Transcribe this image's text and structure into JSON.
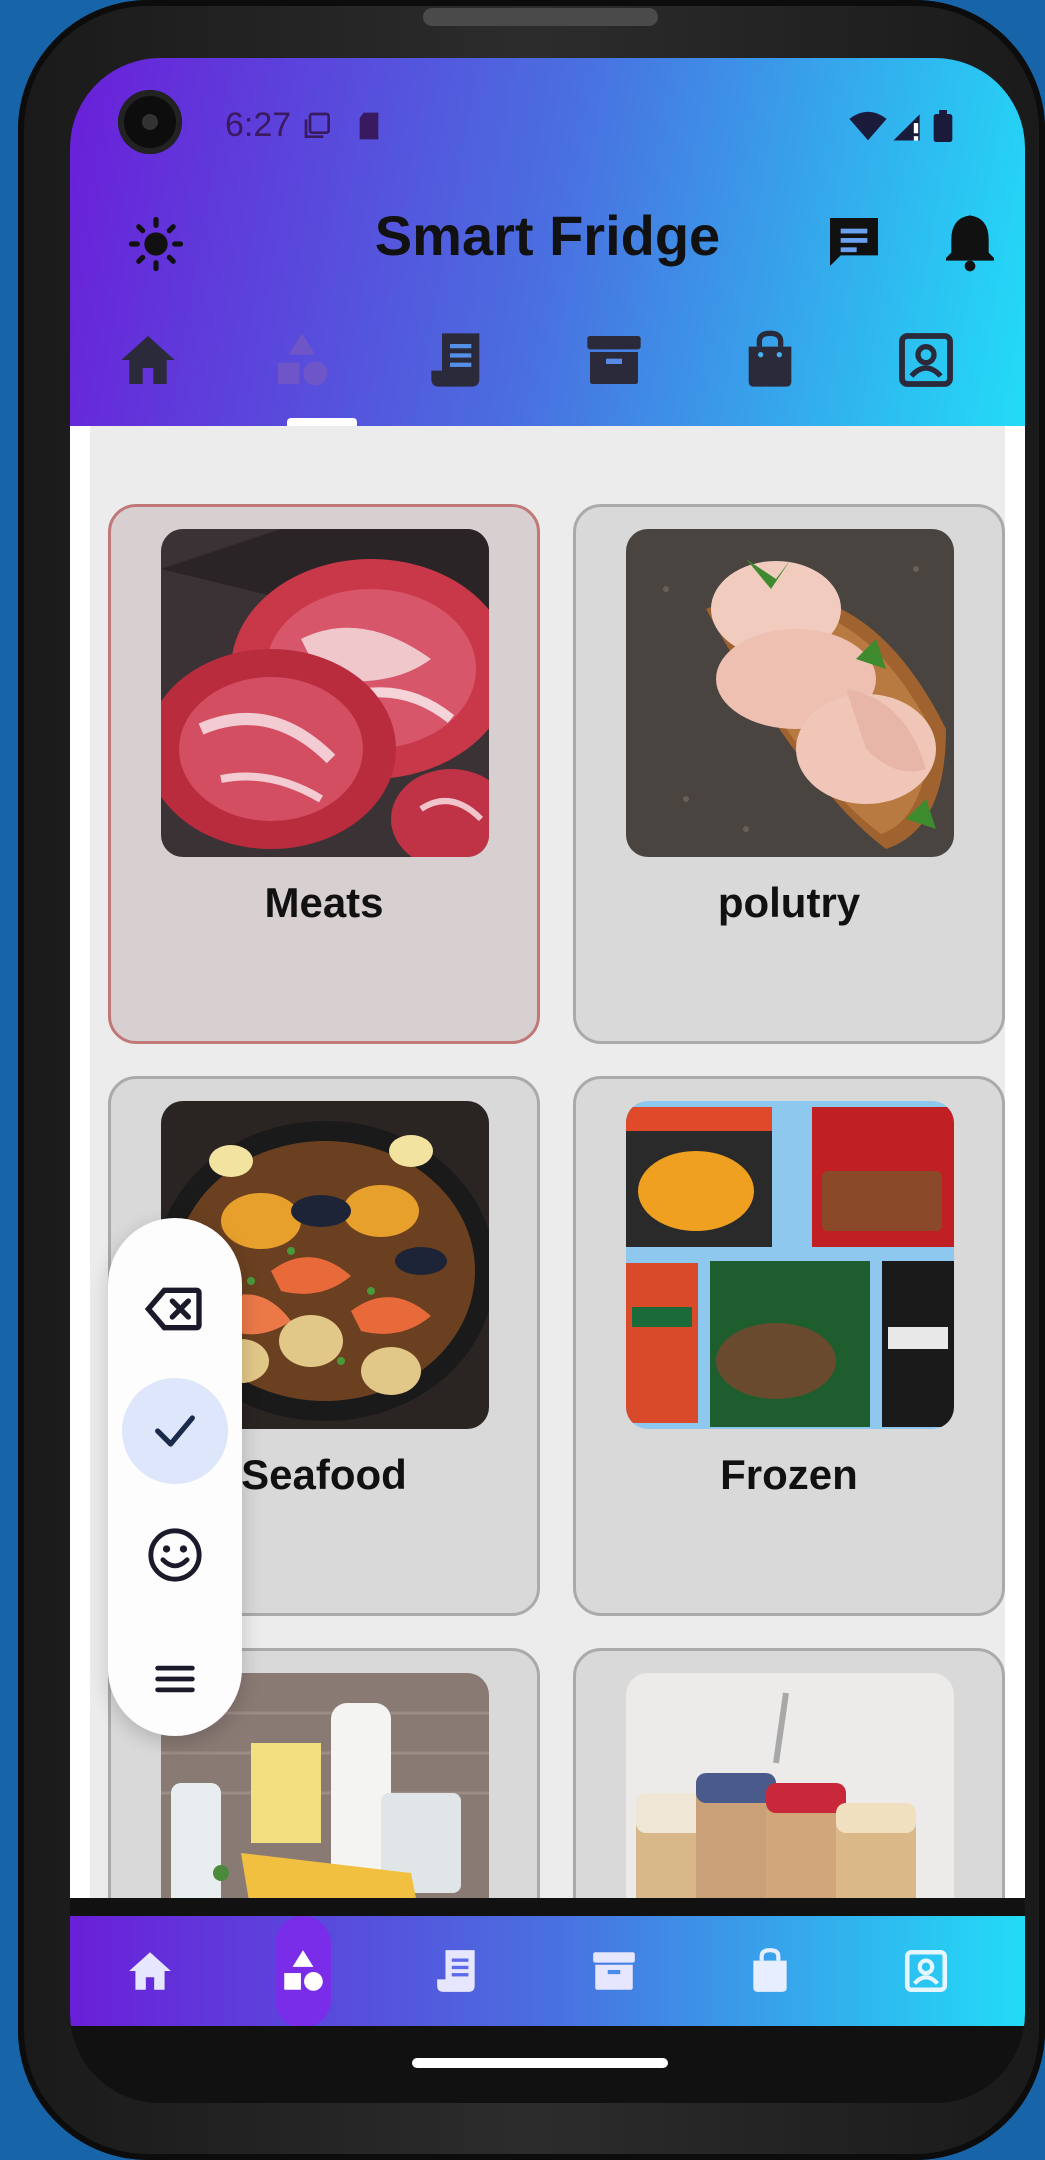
{
  "status": {
    "time": "6:27"
  },
  "header": {
    "title": "Smart Fridge"
  },
  "tabs": [
    {
      "name": "home-icon"
    },
    {
      "name": "categories-icon"
    },
    {
      "name": "receipt-icon"
    },
    {
      "name": "archive-icon"
    },
    {
      "name": "shopping-bag-icon"
    },
    {
      "name": "profile-icon"
    }
  ],
  "categories": [
    {
      "label": "Meats"
    },
    {
      "label": "polutry"
    },
    {
      "label": "Seafood"
    },
    {
      "label": "Frozen"
    },
    {
      "label": ""
    },
    {
      "label": ""
    }
  ],
  "floating_menu": [
    {
      "name": "backspace-icon"
    },
    {
      "name": "check-icon"
    },
    {
      "name": "smiley-icon"
    },
    {
      "name": "menu-icon"
    }
  ],
  "colors": {
    "gradient_start": "#6a1fd8",
    "gradient_end": "#22dcf7",
    "active_tab": "#7a2de8",
    "selected_border": "#c07878"
  }
}
